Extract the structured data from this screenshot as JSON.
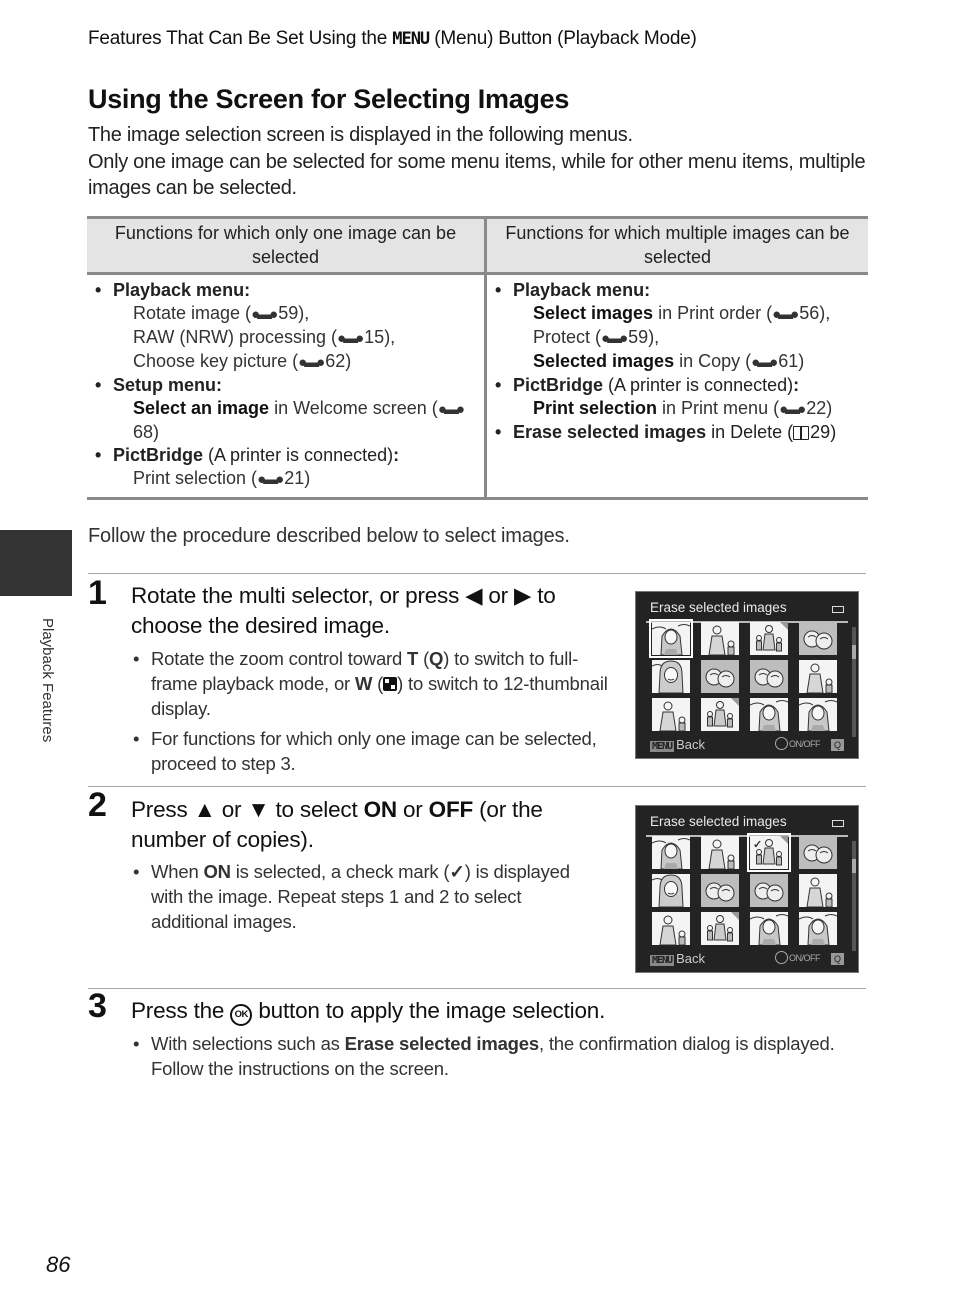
{
  "running_header": {
    "prefix": "Features That Can Be Set Using the ",
    "menu_glyph": "MENU",
    "suffix": " (Menu) Button (Playback Mode)"
  },
  "title": "Using the Screen for Selecting Images",
  "intro": [
    "The image selection screen is displayed in the following menus.",
    "Only one image can be selected for some menu items, while for other menu items, multiple images can be selected."
  ],
  "table": {
    "headers": [
      "Functions for which only one image can be selected",
      "Functions for which multiple images can be selected"
    ],
    "col1": [
      {
        "heading": "Playback menu:",
        "lines": [
          {
            "bold": "",
            "text": "Rotate image (",
            "ref": "59",
            "end": "),"
          },
          {
            "bold": "",
            "text": "RAW (NRW) processing (",
            "ref": "15",
            "end": "),"
          },
          {
            "bold": "",
            "text": "Choose key picture (",
            "ref": "62",
            "end": ")"
          }
        ]
      },
      {
        "heading": "Setup menu:",
        "lines": [
          {
            "bold": "Select an image",
            "text": " in Welcome screen (",
            "ref": "68",
            "end": ")"
          }
        ]
      },
      {
        "heading": "PictBridge",
        "heading_rest": " (A printer is connected)",
        "colon": ":",
        "lines": [
          {
            "bold": "",
            "text": "Print selection (",
            "ref": "21",
            "end": ")"
          }
        ]
      }
    ],
    "col2": [
      {
        "heading": "Playback menu:",
        "lines": [
          {
            "bold": "Select images",
            "text": " in Print order (",
            "ref": "56",
            "end": "),"
          },
          {
            "bold": "",
            "text": "Protect (",
            "ref": "59",
            "end": "),"
          },
          {
            "bold": "Selected images",
            "text": " in Copy (",
            "ref": "61",
            "end": ")"
          }
        ]
      },
      {
        "heading": "PictBridge",
        "heading_rest": " (A printer is connected)",
        "colon": ":",
        "lines": [
          {
            "bold": "Print selection",
            "text": " in Print menu (",
            "ref": "22",
            "end": ")"
          }
        ]
      },
      {
        "heading": "Erase selected images",
        "heading_rest": " in Delete (",
        "book_ref": "29",
        "heading_end": ")"
      }
    ],
    "ref_icon": "reference-binoculars-icon",
    "ref_glyph": "●▬●"
  },
  "follow_text": "Follow the procedure described below to select images.",
  "steps": [
    {
      "number": "1",
      "title_parts": [
        "Rotate the multi selector, or press ",
        "◀",
        " or ",
        "▶",
        " to choose the desired image."
      ],
      "bullets": [
        {
          "p1": "Rotate the zoom control toward ",
          "b1": "T",
          "p2": " (",
          "glyph1": "Q",
          "p3": ") to switch to full-frame playback mode, or ",
          "b2": "W",
          "p4": " (",
          "p5": ") to switch to 12-thumbnail display."
        },
        {
          "text": "For functions for which only one image can be selected, proceed to step 3."
        }
      ]
    },
    {
      "number": "2",
      "title_parts": [
        "Press ",
        "▲",
        " or ",
        "▼",
        " to select ",
        "ON",
        " or ",
        "OFF",
        " (or the number of copies)."
      ],
      "bullets": [
        {
          "p1": "When ",
          "b1": "ON",
          "p2": " is selected, a check mark (",
          "glyph": "✓",
          "p3": ") is displayed with the image. Repeat steps 1 and 2 to select additional images."
        }
      ]
    },
    {
      "number": "3",
      "title_parts": [
        "Press the ",
        "OK",
        " button to apply the image selection."
      ],
      "bullets": [
        {
          "p1": "With selections such as ",
          "b1": "Erase selected images",
          "p2": ", the confirmation dialog is displayed. Follow the instructions on the screen."
        }
      ]
    }
  ],
  "camera_screens": [
    {
      "title": "Erase selected images",
      "selected_index": 0,
      "checked_index": -1,
      "footer_menu": "MENU",
      "footer_back": "Back",
      "footer_onoff": "ON/OFF",
      "footer_zoom": "Q"
    },
    {
      "title": "Erase selected images",
      "selected_index": 2,
      "checked_index": 2,
      "footer_menu": "MENU",
      "footer_back": "Back",
      "footer_onoff": "ON/OFF",
      "footer_zoom": "Q"
    }
  ],
  "thumbnails": [
    "portrait-hood",
    "woman-child",
    "family-walk",
    "flowers",
    "portrait-smile",
    "flowers",
    "flowers",
    "woman-child",
    "woman-child",
    "family-walk",
    "portrait-hood",
    "portrait-hood"
  ],
  "side_tab": {
    "label": "Playback Features"
  },
  "page_number": "86"
}
